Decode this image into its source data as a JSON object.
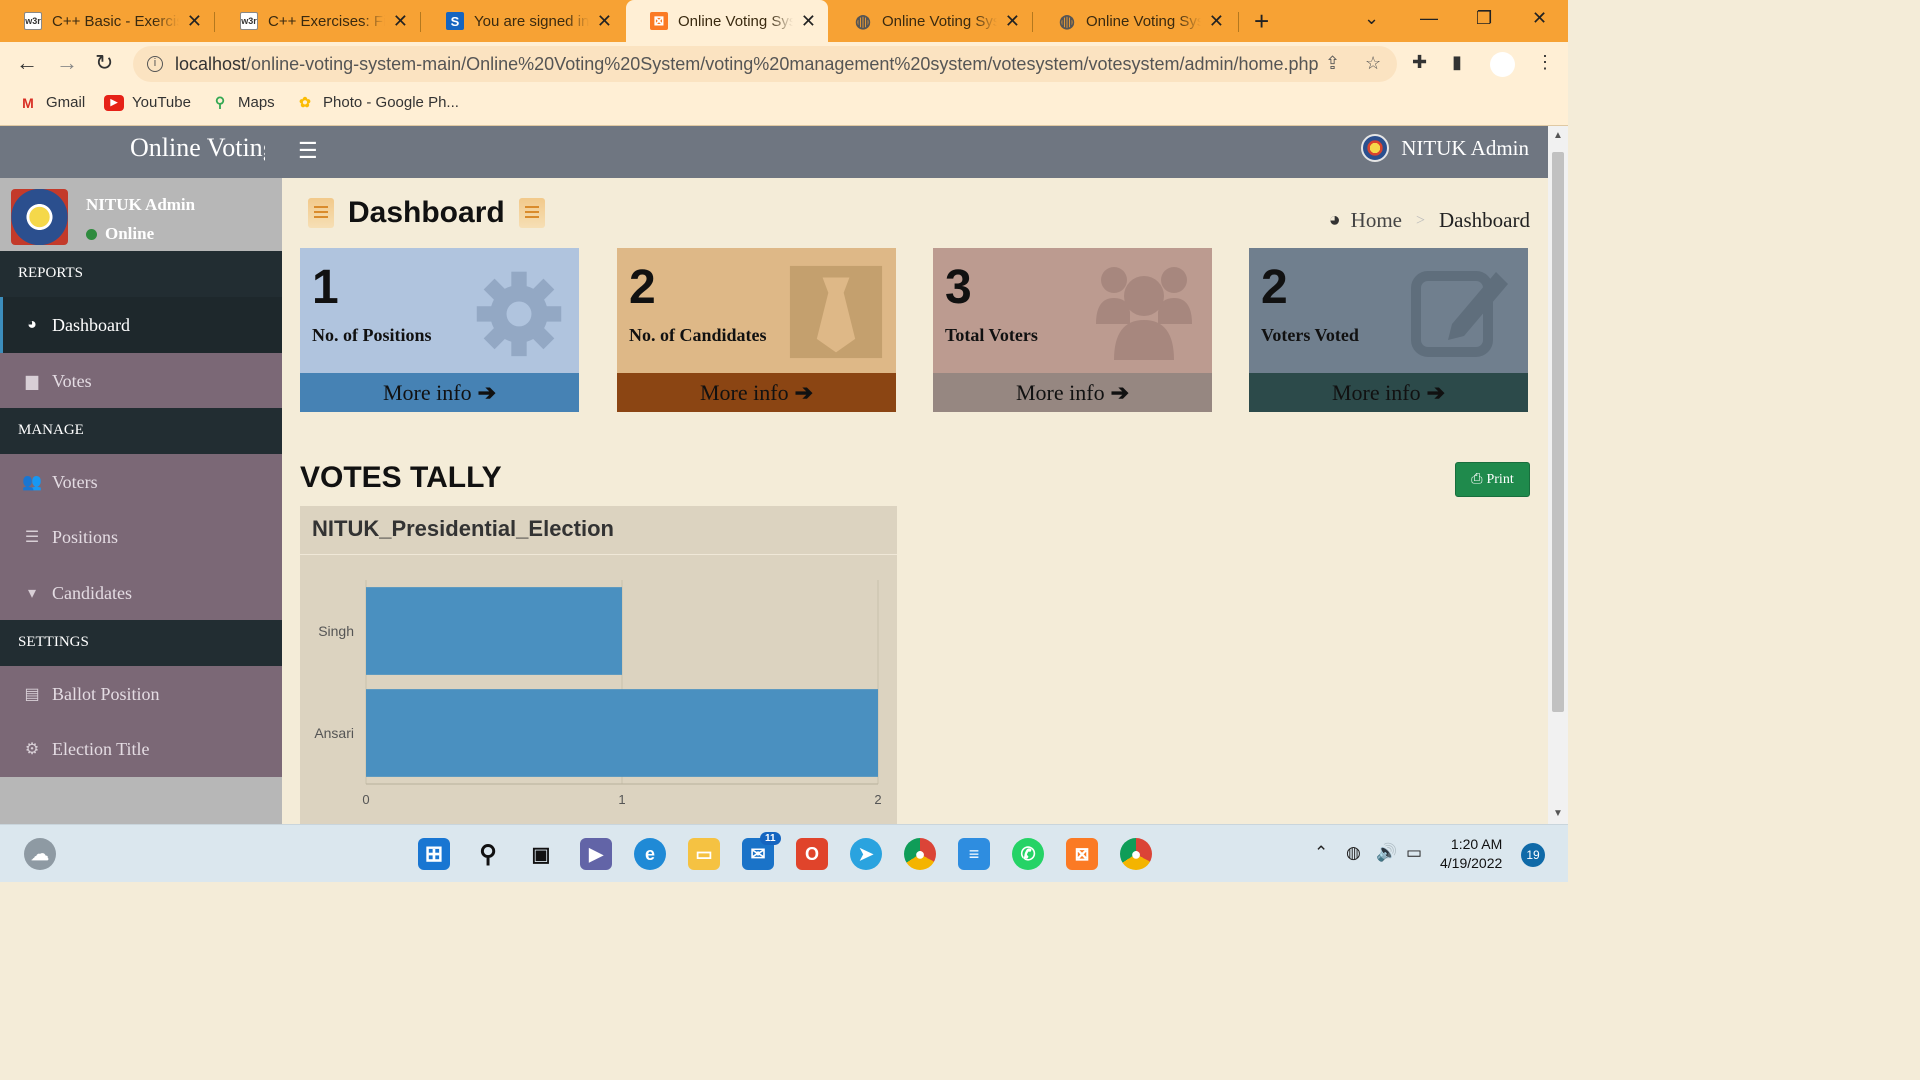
{
  "browser": {
    "tabs": [
      {
        "title": "C++ Basic - Exercises",
        "icon": "w3r-icon",
        "fav_text": "w3r"
      },
      {
        "title": "C++ Exercises: Find",
        "icon": "w3r-icon",
        "fav_text": "w3r"
      },
      {
        "title": "You are signed in as",
        "icon": "s-icon",
        "fav_text": "S"
      },
      {
        "title": "Online Voting System",
        "icon": "xampp-icon",
        "fav_text": "⊠"
      },
      {
        "title": "Online Voting System",
        "icon": "globe-icon",
        "fav_text": "◍"
      },
      {
        "title": "Online Voting System",
        "icon": "globe-icon",
        "fav_text": "◍"
      }
    ],
    "active_tab": 3,
    "url_host": "localhost",
    "url_path": "/online-voting-system-main/Online%20Voting%20System/voting%20management%20system/votesystem/votesystem/admin/home.php",
    "bookmarks": [
      {
        "label": "Gmail",
        "icon": "gmail-icon"
      },
      {
        "label": "YouTube",
        "icon": "youtube-icon"
      },
      {
        "label": "Maps",
        "icon": "maps-icon"
      },
      {
        "label": "Photo - Google Ph...",
        "icon": "photos-icon"
      }
    ]
  },
  "header": {
    "logo": "Online Voting System",
    "user": "NITUK Admin"
  },
  "sidebar": {
    "user_name": "NITUK Admin",
    "status": "Online",
    "sections": [
      {
        "header": "REPORTS",
        "items": [
          {
            "label": "Dashboard",
            "icon": "dashboard-icon",
            "active": true
          },
          {
            "label": "Votes",
            "icon": "lock-icon"
          }
        ]
      },
      {
        "header": "MANAGE",
        "items": [
          {
            "label": "Voters",
            "icon": "users-icon"
          },
          {
            "label": "Positions",
            "icon": "list-icon"
          },
          {
            "label": "Candidates",
            "icon": "tie-icon"
          }
        ]
      },
      {
        "header": "SETTINGS",
        "items": [
          {
            "label": "Ballot Position",
            "icon": "file-icon"
          },
          {
            "label": "Election Title",
            "icon": "cogs-icon"
          }
        ]
      }
    ]
  },
  "page": {
    "title": "Dashboard",
    "breadcrumb_home": "Home",
    "breadcrumb_current": "Dashboard"
  },
  "stats": [
    {
      "value": "1",
      "label": "No. of Positions",
      "more": "More info",
      "icon": "gear-icon",
      "bg": "#b0c4de",
      "foot": "#4682b4"
    },
    {
      "value": "2",
      "label": "No. of Candidates",
      "more": "More info",
      "icon": "tie-icon",
      "bg": "#deb887",
      "foot": "#8b4513"
    },
    {
      "value": "3",
      "label": "Total Voters",
      "more": "More info",
      "icon": "users-icon",
      "bg": "#bc9b90",
      "foot": "#968781"
    },
    {
      "value": "2",
      "label": "Voters Voted",
      "more": "More info",
      "icon": "edit-icon",
      "bg": "#707f8e",
      "foot": "#2c4a4a"
    }
  ],
  "tally": {
    "title": "VOTES TALLY",
    "print_label": "Print"
  },
  "chart_data": {
    "type": "bar",
    "orientation": "horizontal",
    "title": "NITUK_Presidential_Election",
    "categories": [
      "Singh",
      "Ansari"
    ],
    "values": [
      1,
      2
    ],
    "xlim": [
      0,
      2
    ],
    "xticks": [
      0,
      1,
      2
    ],
    "bar_color": "#4a90c0",
    "grid": true
  },
  "taskbar": {
    "mail_badge": "11",
    "time": "1:20 AM",
    "date": "4/19/2022",
    "notifications": "19"
  }
}
